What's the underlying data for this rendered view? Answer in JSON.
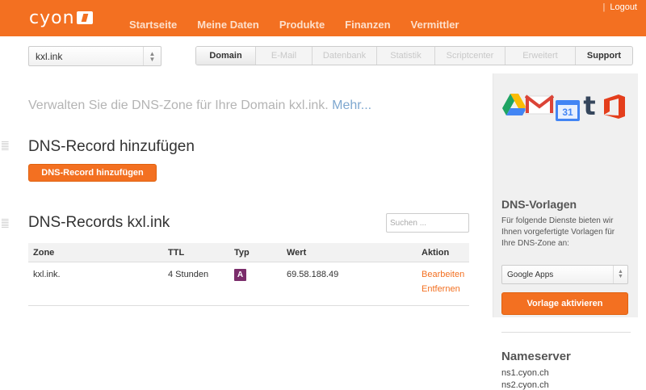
{
  "brand": {
    "logo_text": "cyon"
  },
  "nav": {
    "items": [
      {
        "label": "Startseite"
      },
      {
        "label": "Meine Daten"
      },
      {
        "label": "Produkte"
      },
      {
        "label": "Finanzen"
      },
      {
        "label": "Vermittler"
      }
    ],
    "logout_sep": "|",
    "logout_label": "Logout"
  },
  "domain_select": {
    "value": "kxl.ink"
  },
  "tabs": [
    {
      "label": "Domain",
      "state": "active"
    },
    {
      "label": "E-Mail",
      "state": "disabled"
    },
    {
      "label": "Datenbank",
      "state": "disabled"
    },
    {
      "label": "Statistik",
      "state": "disabled"
    },
    {
      "label": "Scriptcenter",
      "state": "disabled"
    },
    {
      "label": "Erweitert",
      "state": "disabled"
    },
    {
      "label": "Support",
      "state": "normal"
    }
  ],
  "main": {
    "intro_text": "Verwalten Sie die DNS-Zone für Ihre Domain kxl.ink.",
    "intro_more": "Mehr...",
    "add_section_title": "DNS-Record hinzufügen",
    "add_button_label": "DNS-Record hinzufügen",
    "records_title": "DNS-Records kxl.ink",
    "search_placeholder": "Suchen ...",
    "table": {
      "columns": [
        "Zone",
        "TTL",
        "Typ",
        "Wert",
        "Aktion"
      ],
      "rows": [
        {
          "zone": "kxl.ink.",
          "ttl": "4 Stunden",
          "typ": "A",
          "wert": "69.58.188.49",
          "actions": [
            "Bearbeiten",
            "Entfernen"
          ]
        }
      ]
    }
  },
  "sidebar": {
    "icons": [
      "google-drive-icon",
      "gmail-icon",
      "google-calendar-icon",
      "tumblr-icon",
      "office-icon"
    ],
    "calendar_number": "31",
    "tumblr_letter": "t",
    "templates_title": "DNS-Vorlagen",
    "templates_text": "Für folgende Dienste bieten wir Ihnen vorgefertigte Vorlagen für Ihre DNS-Zone an:",
    "templates_select_value": "Google Apps",
    "activate_button_label": "Vorlage aktivieren",
    "nameserver_title": "Nameserver",
    "nameservers": [
      "ns1.cyon.ch",
      "ns2.cyon.ch"
    ]
  },
  "colors": {
    "accent": "#f37021",
    "record_type_a": "#7b2d6b",
    "link": "#7ea7cf"
  }
}
